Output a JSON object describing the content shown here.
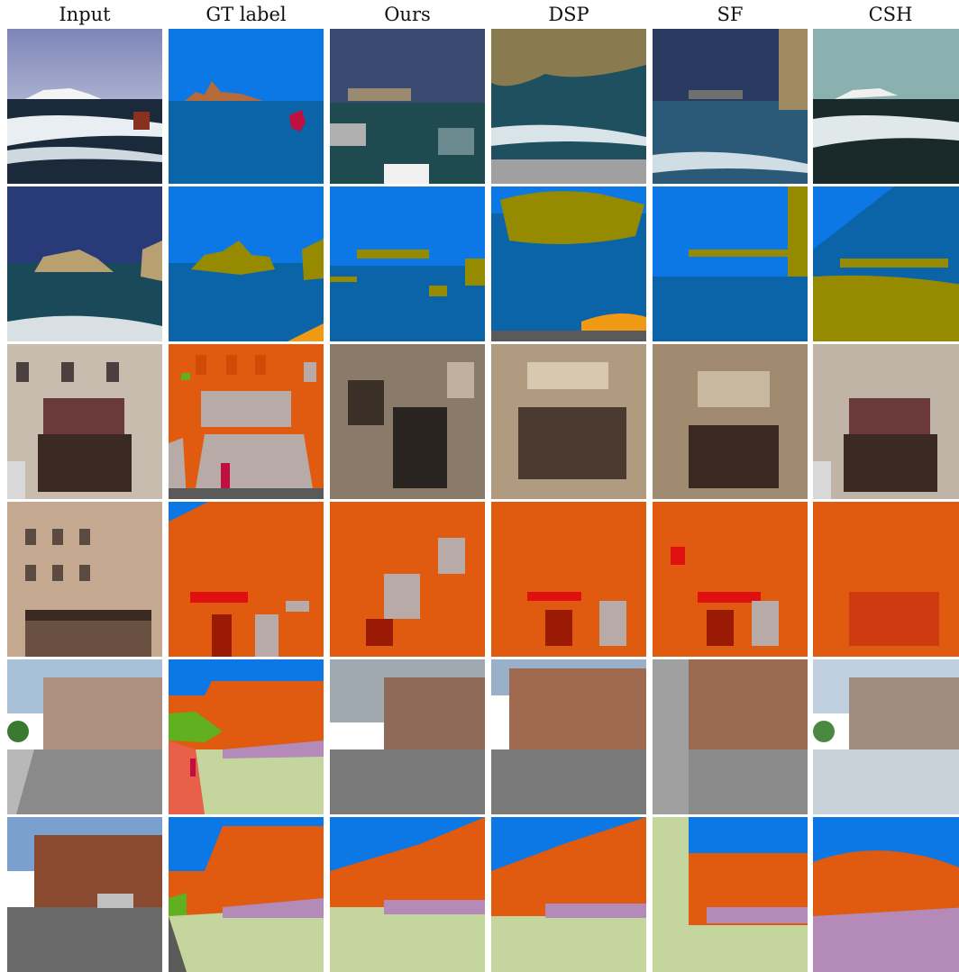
{
  "columns": [
    "Input",
    "GT label",
    "Ours",
    "DSP",
    "SF",
    "CSH"
  ],
  "colors": {
    "sky": "#0b78e6",
    "sea": "#0c64a8",
    "rock": "#968a00",
    "boat": "#b56a3a",
    "person": "#c01040",
    "building": "#e05a0f",
    "window": "#b8aaa6",
    "awning": "#e01010",
    "door": "#9a1a06",
    "road": "#5a5a5a",
    "sidewalk": "#c4d59e",
    "car": "#b48ab8",
    "tree": "#60b020",
    "crosswalk": "#e8604a",
    "sand": "#f09a14"
  }
}
